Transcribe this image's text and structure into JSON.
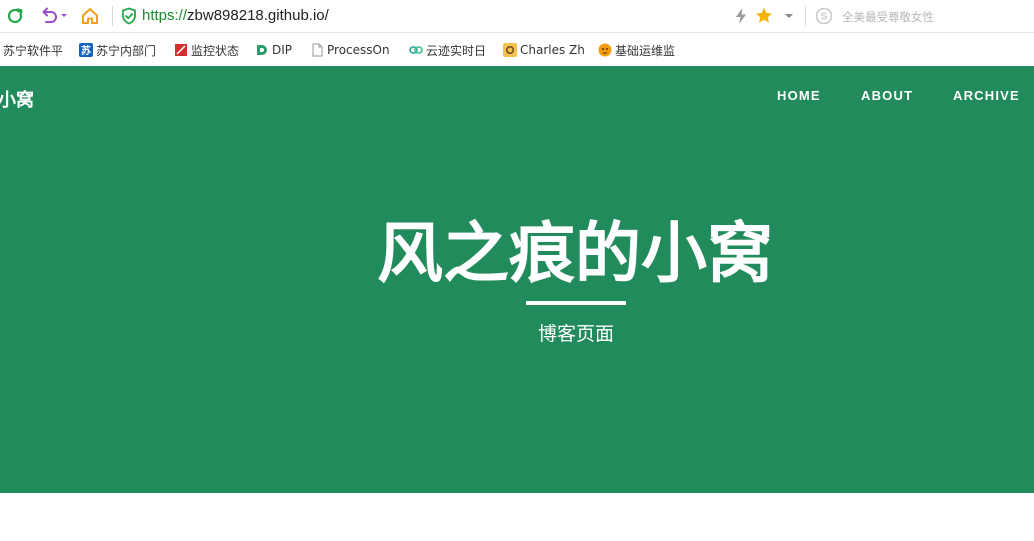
{
  "browser": {
    "url_scheme": "https://",
    "url_rest": "zbw898218.github.io/",
    "search_hint": "全美最受尊敬女性"
  },
  "bookmarks": [
    {
      "label": "苏宁软件平",
      "icon": "none"
    },
    {
      "label": "苏宁内部门",
      "icon": "suning-icon"
    },
    {
      "label": "监控状态",
      "icon": "monitor-icon"
    },
    {
      "label": "DIP",
      "icon": "dip-icon"
    },
    {
      "label": "ProcessOn",
      "icon": "page-icon"
    },
    {
      "label": "云迹实时日",
      "icon": "link-icon"
    },
    {
      "label": "Charles Zh",
      "icon": "avatar-icon"
    },
    {
      "label": "基础运维监",
      "icon": "tiger-icon"
    }
  ],
  "site": {
    "brand": "小窝",
    "nav": [
      "HOME",
      "ABOUT",
      "ARCHIVE"
    ],
    "title": "风之痕的小窝",
    "subtitle": "博客页面"
  },
  "colors": {
    "hero_bg": "#228b5b",
    "url_scheme": "#1a8a2e",
    "star": "#f5b301",
    "home_icon": "#f0a020",
    "undo_icon": "#9b4dca",
    "refresh_icon": "#22a845"
  }
}
